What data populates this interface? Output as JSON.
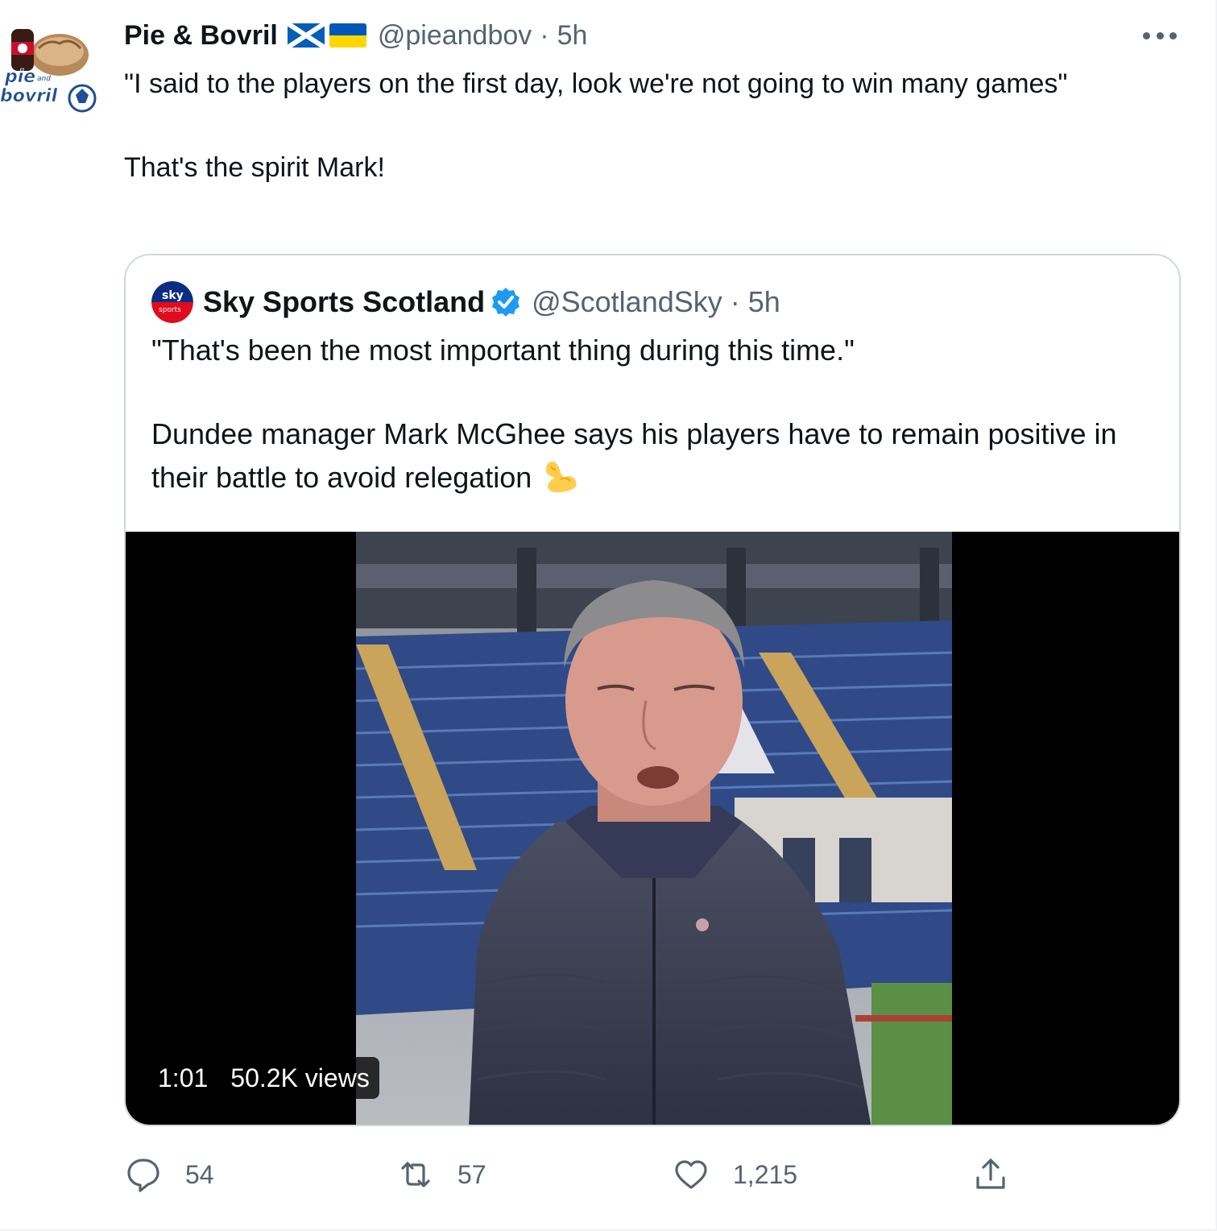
{
  "tweet": {
    "display_name": "Pie & Bovril",
    "flags": [
      "scotland-flag-icon",
      "ukraine-flag-icon"
    ],
    "handle": "@pieandbov",
    "separator": "·",
    "time": "5h",
    "text_line1": "\"I said to the players on the first day, look we're not going to win many games\"",
    "text_line2": "That's the spirit Mark!"
  },
  "quoted_tweet": {
    "display_name": "Sky Sports Scotland",
    "verified": true,
    "handle": "@ScotlandSky",
    "separator": "·",
    "time": "5h",
    "text_line1": "\"That's been the most important thing during this time.\"",
    "text_line2": "Dundee manager Mark McGhee says his players have to remain positive in their battle to avoid relegation",
    "emoji": "flexed-biceps-icon",
    "video": {
      "duration": "1:01",
      "views": "50.2K views"
    }
  },
  "actions": {
    "replies": "54",
    "retweets": "57",
    "likes": "1,215"
  },
  "colors": {
    "text": "#0f1419",
    "secondary": "#536471",
    "border": "#cfd9de",
    "verified": "#1d9bf0",
    "scotland_blue": "#005eb8",
    "ukraine_blue": "#0057b7",
    "ukraine_yellow": "#ffd700"
  }
}
